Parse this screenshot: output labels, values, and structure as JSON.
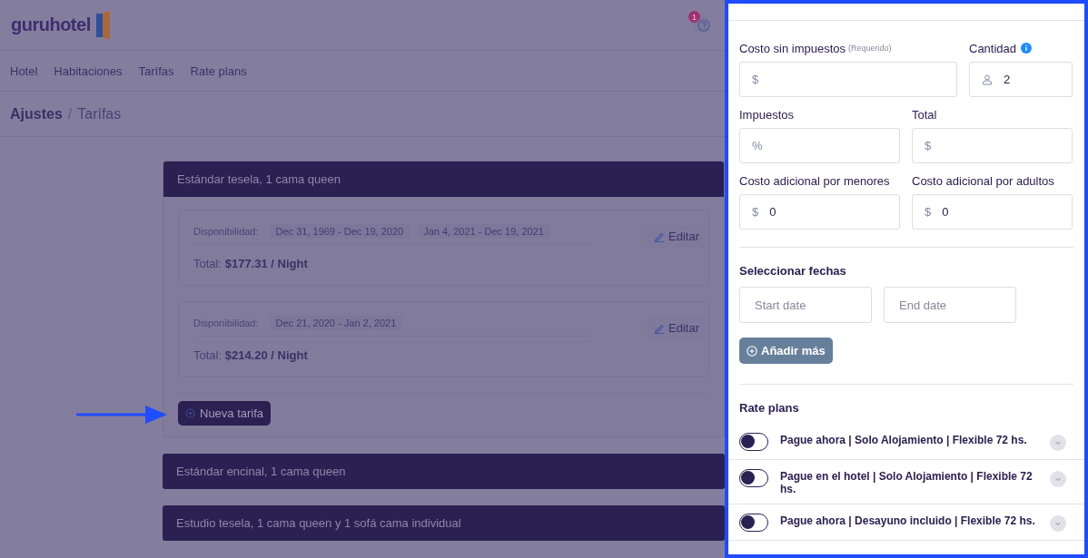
{
  "header": {
    "logo": "guruhotel",
    "notification_count": "1"
  },
  "nav": [
    {
      "label": "Hotel"
    },
    {
      "label": "Habitaciones"
    },
    {
      "label": "Tarífas"
    },
    {
      "label": "Rate plans"
    }
  ],
  "breadcrumb": {
    "section": "Ajustes",
    "separator": "/",
    "page": "Tarífas"
  },
  "rooms": [
    {
      "title": "Estándar tesela, 1 cama queen",
      "expanded": true,
      "rates": [
        {
          "availability_label": "Disponibilidad:",
          "ranges": [
            "Dec 31, 1969 - Dec 19, 2020",
            "Jan 4, 2021 - Dec 19, 2021"
          ],
          "total_label": "Total:",
          "total": "$177.31 / Night",
          "edit": "Editar"
        },
        {
          "availability_label": "Disponibilidad:",
          "ranges": [
            "Dec 21, 2020 - Jan 2, 2021"
          ],
          "total_label": "Total:",
          "total": "$214.20 / Night",
          "edit": "Editar"
        }
      ],
      "new_rate": "Nueva tarifa"
    },
    {
      "title": "Estándar encinal, 1 cama queen",
      "expanded": false
    },
    {
      "title": "Estudio tesela, 1 cama queen y 1 sofá cama individual",
      "expanded": false
    }
  ],
  "drawer": {
    "field_rows": [
      [
        {
          "label": "Costo sin impuestos",
          "note": "(Requerido)",
          "kind": "currency",
          "prefix": "$"
        },
        {
          "label": "Cantidad",
          "info": true,
          "kind": "people",
          "value": "2"
        }
      ],
      [
        {
          "label": "Impuestos",
          "kind": "currency",
          "prefix": "%"
        },
        {
          "label": "Total",
          "kind": "currency",
          "prefix": "$"
        }
      ],
      [
        {
          "label": "Costo adicional por menores",
          "kind": "currency",
          "prefix": "$",
          "value": "0"
        },
        {
          "label": "Costo adicional por adultos",
          "kind": "currency",
          "prefix": "$",
          "value": "0"
        }
      ]
    ],
    "dates": {
      "title": "Seleccionar fechas",
      "start_placeholder": "Start date",
      "end_placeholder": "End date",
      "add_button": "Añadir más"
    },
    "rate_plans": {
      "title": "Rate plans",
      "items": [
        {
          "name": "Pague ahora | Solo Alojamiento | Flexible 72 hs.",
          "on": false
        },
        {
          "name": "Pague en el hotel | Solo Alojamiento | Flexible 72 hs.",
          "on": false
        },
        {
          "name": "Pague ahora | Desayuno incluido | Flexible 72 hs.",
          "on": false
        }
      ]
    }
  }
}
